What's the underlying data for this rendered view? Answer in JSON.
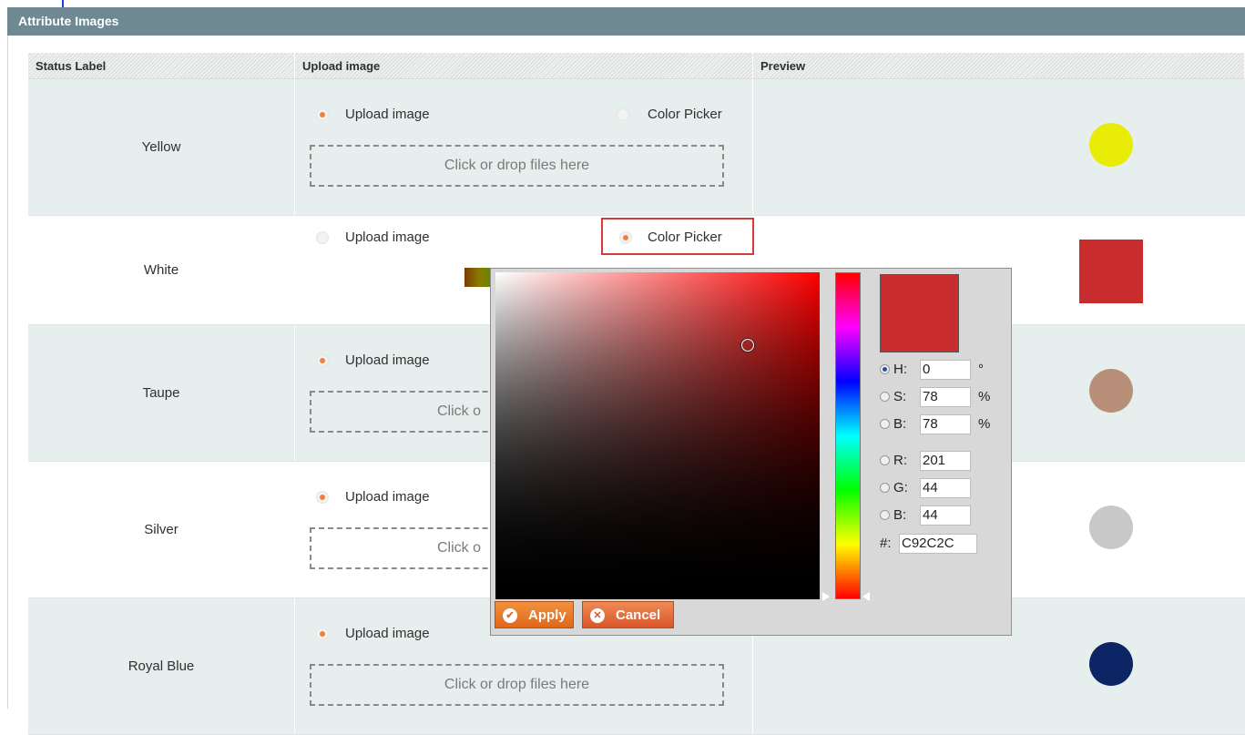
{
  "panel": {
    "title": "Attribute Images"
  },
  "table": {
    "headers": [
      "Status Label",
      "Upload image",
      "Preview"
    ],
    "rows": [
      {
        "label": "Yellow",
        "option_upload": "Upload image",
        "option_picker": "Color Picker",
        "dropzone": "Click or drop files here",
        "preview_color": "#e8ec06",
        "preview_shape": "circle"
      },
      {
        "label": "White",
        "option_upload": "Upload image",
        "option_picker": "Color Picker",
        "preview_color": "#c92c2c",
        "preview_shape": "square"
      },
      {
        "label": "Taupe",
        "option_upload": "Upload image",
        "dropzone": "Click o",
        "preview_color": "#b8907a",
        "preview_shape": "circle"
      },
      {
        "label": "Silver",
        "option_upload": "Upload image",
        "dropzone": "Click o",
        "preview_color": "#c8c8c8",
        "preview_shape": "circle"
      },
      {
        "label": "Royal Blue",
        "option_upload": "Upload image",
        "dropzone": "Click or drop files here",
        "preview_color": "#0b2565",
        "preview_shape": "circle"
      }
    ]
  },
  "colorpicker": {
    "new_color": "#c92c2c",
    "fields": {
      "h": {
        "label": "H:",
        "value": "0",
        "unit": "°"
      },
      "s": {
        "label": "S:",
        "value": "78",
        "unit": "%"
      },
      "b": {
        "label": "B:",
        "value": "78",
        "unit": "%"
      },
      "r": {
        "label": "R:",
        "value": "201"
      },
      "g": {
        "label": "G:",
        "value": "44"
      },
      "bl": {
        "label": "B:",
        "value": "44"
      },
      "hex": {
        "label": "#:",
        "value": "C92C2C"
      }
    },
    "apply_label": "Apply",
    "cancel_label": "Cancel"
  }
}
